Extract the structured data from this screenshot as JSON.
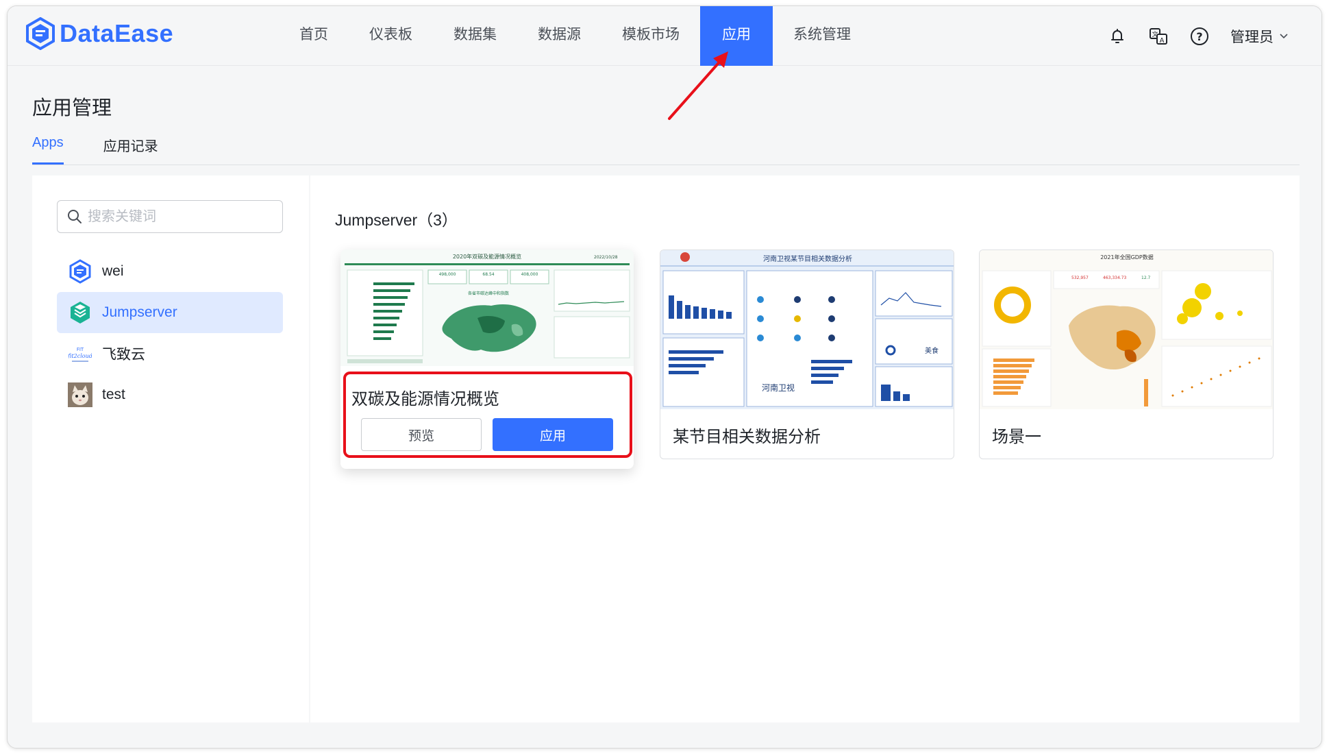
{
  "header": {
    "logo_text": "DataEase",
    "nav": [
      {
        "label": "首页"
      },
      {
        "label": "仪表板"
      },
      {
        "label": "数据集"
      },
      {
        "label": "数据源"
      },
      {
        "label": "模板市场"
      },
      {
        "label": "应用",
        "active": true
      },
      {
        "label": "系统管理"
      }
    ],
    "user": "管理员",
    "accent": "#3370ff"
  },
  "page": {
    "title": "应用管理",
    "tabs": [
      {
        "label": "Apps",
        "active": true
      },
      {
        "label": "应用记录"
      }
    ]
  },
  "sidebar": {
    "search_placeholder": "搜索关键词",
    "items": [
      {
        "name": "wei",
        "icon": "dataease-logo-icon"
      },
      {
        "name": "Jumpserver",
        "icon": "jumpserver-logo-icon",
        "active": true
      },
      {
        "name": "飞致云",
        "icon": "fit2cloud-logo-icon"
      },
      {
        "name": "test",
        "icon": "cat-avatar-icon"
      }
    ]
  },
  "main": {
    "section_title": "Jumpserver（3）",
    "cards": [
      {
        "name": "双碳及能源情况概览",
        "thumb_title": "2020年双碳及能源情况概览",
        "thumb_date": "2022/10/28",
        "thumb_map_title": "各省市碳达峰中和指数",
        "thumb_stats": [
          "498,000",
          "68.54",
          "408,000"
        ]
      },
      {
        "name": "某节目相关数据分析",
        "thumb_title": "河南卫视某节目相关数据分析",
        "thumb_text": [
          "河南卫视",
          "美食"
        ]
      },
      {
        "name": "场景一",
        "thumb_title": "2021年全国GDP数据",
        "thumb_stats": [
          "532,957",
          "463,334.73",
          "12.7"
        ]
      }
    ],
    "buttons": {
      "preview": "预览",
      "apply": "应用"
    }
  },
  "annotation": {
    "highlight_color": "#e8101a"
  }
}
